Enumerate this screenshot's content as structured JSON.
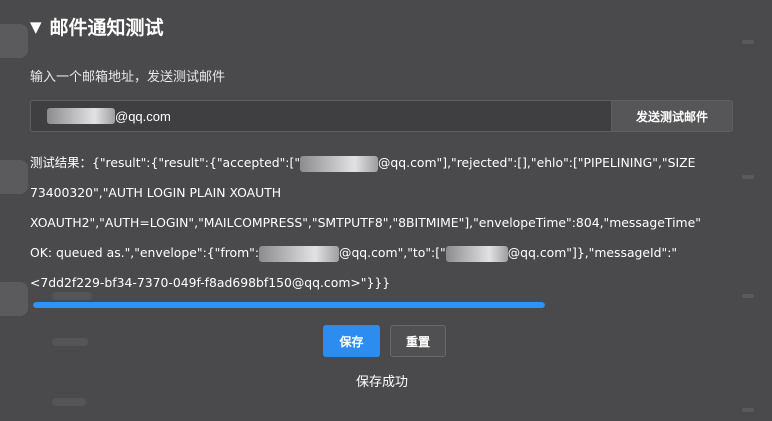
{
  "section": {
    "title": "邮件通知测试",
    "collapse_glyph": "▼"
  },
  "email": {
    "hint": "输入一个邮箱地址，发送测试邮件",
    "value_suffix": "@qq.com",
    "send_label": "发送测试邮件"
  },
  "result": {
    "lines": [
      {
        "before": "测试结果：{\"result\":{\"result\":{\"accepted\":[\"",
        "after": "@qq.com\"],\"rejected\":[],\"ehlo\":[\"PIPELINING\",\"SIZE"
      },
      {
        "before": "73400320\",\"AUTH LOGIN PLAIN XOAUTH",
        "after": ""
      },
      {
        "before": "XOAUTH2\",\"AUTH=LOGIN\",\"MAILCOMPRESS\",\"SMTPUTF8\",\"8BITMIME\"],\"envelopeTime\":804,\"messageTime\"",
        "after": ""
      },
      {
        "before": "OK: queued as.\",\"envelope\":{\"from\":",
        "mid": "@qq.com\",\"to\":[\"",
        "after": "@qq.com\"]},\"messageId\":\""
      },
      {
        "before": "<7dd2f229-bf34-7370-049f-f8ad698bf150@qq.com>\"}}}",
        "after": ""
      }
    ]
  },
  "progress": {
    "percent": 100
  },
  "actions": {
    "save_label": "保存",
    "reset_label": "重置",
    "status": "保存成功"
  },
  "colors": {
    "accent": "#2d8cf0",
    "progress": "#2e93f7",
    "overlay_bg": "#4a4a4c"
  }
}
